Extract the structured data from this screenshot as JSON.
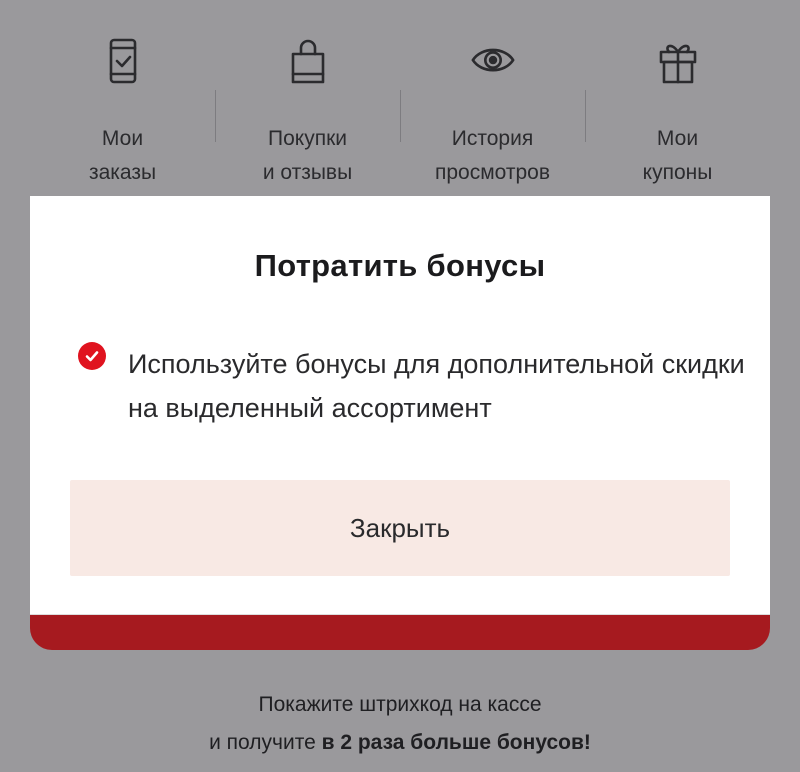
{
  "nav": {
    "items": [
      {
        "icon": "phone-check-icon",
        "label_line1": "Мои",
        "label_line2": "заказы"
      },
      {
        "icon": "shopping-bag-icon",
        "label_line1": "Покупки",
        "label_line2": "и отзывы"
      },
      {
        "icon": "eye-icon",
        "label_line1": "История",
        "label_line2": "просмотров"
      },
      {
        "icon": "gift-icon",
        "label_line1": "Мои",
        "label_line2": "купоны"
      }
    ]
  },
  "modal": {
    "title": "Потратить бонусы",
    "info_text": "Используйте бонусы для дополнительной скидки на выделенный ассортимент",
    "close_label": "Закрыть"
  },
  "promo": {
    "line1": "Покажите штрихкод на кассе",
    "line2_prefix": "и получите ",
    "line2_bold": "в 2 раза больше бонусов!"
  },
  "colors": {
    "accent_red": "#e0131f",
    "strip_red": "#a61a1f",
    "button_bg": "#f8e9e4",
    "overlay_gray": "#9a999c"
  }
}
